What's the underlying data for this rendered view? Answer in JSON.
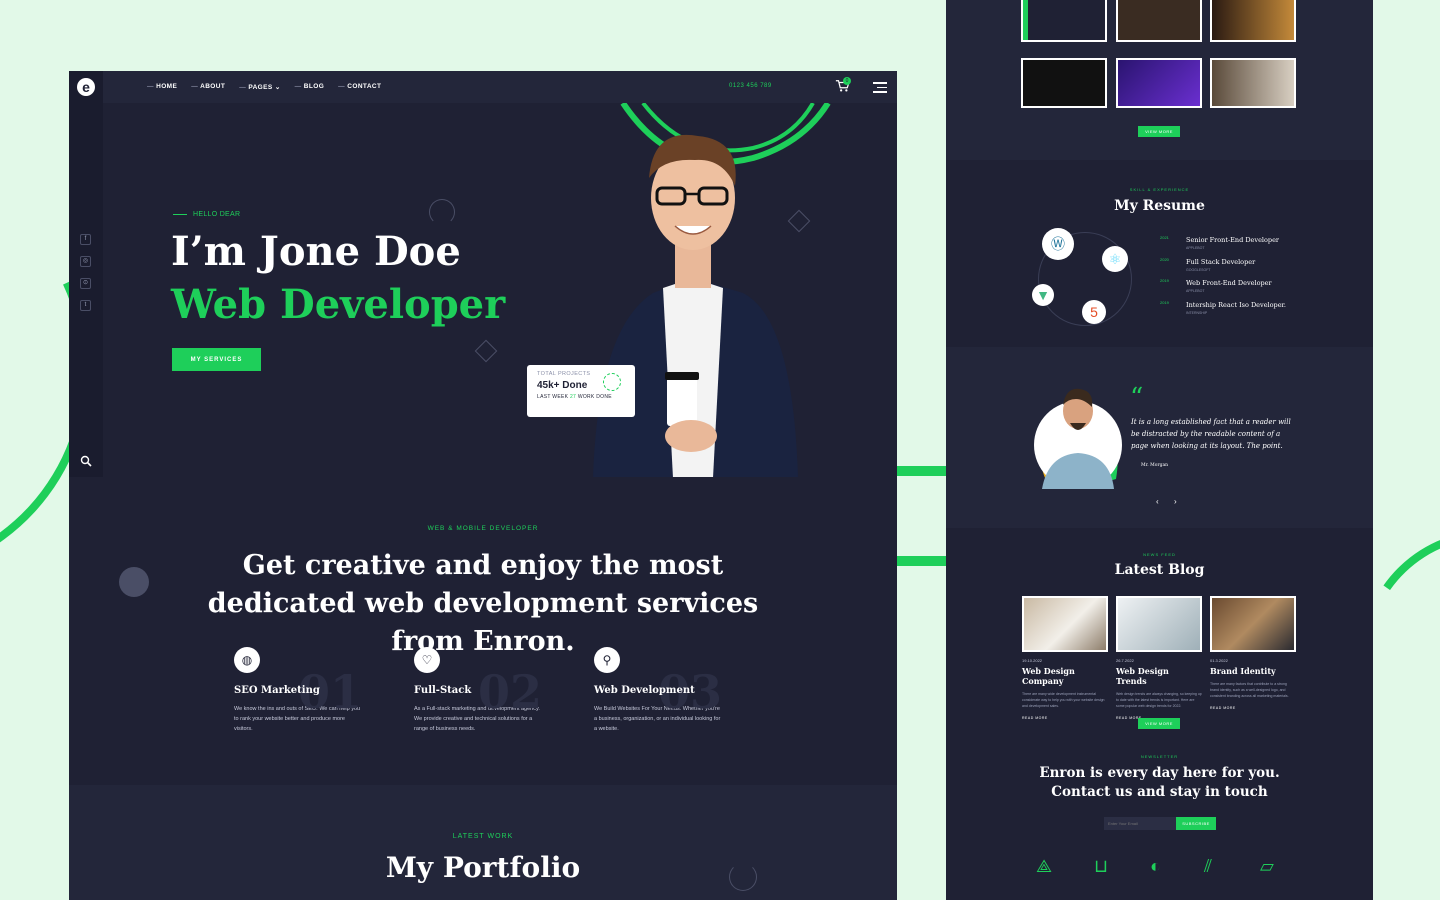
{
  "nav": {
    "logo_letter": "e",
    "items": [
      "HOME",
      "ABOUT",
      "PAGES",
      "BLOG",
      "CONTACT"
    ],
    "phone": "0123 456 789",
    "cart_count": "0"
  },
  "social": [
    "f",
    "◎",
    "⊙",
    "t"
  ],
  "hero": {
    "greeting": "HELLO DEAR",
    "headline_line1": "I’m Jone Doe",
    "headline_line2": "Web Developer",
    "button": "MY SERVICES",
    "card": {
      "label": "TOTAL PROJECTS",
      "value": "45k+ Done",
      "week_pre": "LAST WEEK",
      "week_num": "27",
      "week_post": "WORK DONE"
    }
  },
  "services": {
    "tag": "WEB & MOBILE DEVELOPER",
    "title": "Get creative and enjoy the most dedicated web development services from Enron.",
    "items": [
      {
        "num": "01",
        "name": "SEO Marketing",
        "desc": "We know the ins and outs of SEO. We can help you to rank your website better and produce more visitors."
      },
      {
        "num": "02",
        "name": "Full-Stack",
        "desc": "As a Full-stack marketing and development agency. We provide creative and technical solutions for a range of business needs."
      },
      {
        "num": "03",
        "name": "Web Development",
        "desc": "We Build Websites For Your Needs. Whether you're a business, organization, or an individual looking for a website."
      }
    ]
  },
  "portfolio": {
    "tag": "LATEST WORK",
    "title": "My Portfolio"
  },
  "right": {
    "view_more": "VIEW MORE",
    "resume": {
      "tag": "SKILL & EXPERIENCE",
      "title": "My Resume",
      "items": [
        {
          "year": "2021",
          "role": "Senior Front-End Developer",
          "sub": "APPLEBOT"
        },
        {
          "year": "2020",
          "role": "Full Stack Developer",
          "sub": "GOOGLESOFT"
        },
        {
          "year": "2019",
          "role": "Web Front-End Developer",
          "sub": "APPLEBOT"
        },
        {
          "year": "2019",
          "role": "Intership React Iso Developer.",
          "sub": "INTERNSHIP"
        }
      ]
    },
    "testimonial": {
      "quote": "It is a long established fact that a reader will be distracted by the readable content of a page when looking at its layout. The point.",
      "author": "Mr. Morgan"
    },
    "blog": {
      "tag": "NEWS FEED",
      "title": "Latest Blog",
      "posts": [
        {
          "date": "19.10.2022",
          "title": "Web Design Company",
          "desc": "There are many wide development instrumental considerate way to help you with your website design and development sales.",
          "more": "READ MORE"
        },
        {
          "date": "26.7.2022",
          "title": "Web Design Trends",
          "desc": "Web design trends are always changing, so keeping up to date with the latest trends is important. Here are some popular web design trends for 2022.",
          "more": "READ MORE"
        },
        {
          "date": "01.3.2022",
          "title": "Brand Identity",
          "desc": "There are many factors that contribute to a strong brand identity, such as a well-designed logo, and consistent branding across all marketing materials.",
          "more": "READ MORE"
        }
      ]
    },
    "newsletter": {
      "tag": "NEWSLETTER",
      "title_line1": "Enron is every day here for you.",
      "title_line2": "Contact us and stay in touch",
      "placeholder": "Enter Your Email",
      "button": "SUBSCRIBE"
    }
  },
  "colors": {
    "accent": "#1ecf5a",
    "panel": "#1f2134",
    "page_bg": "#e2f9e8"
  }
}
